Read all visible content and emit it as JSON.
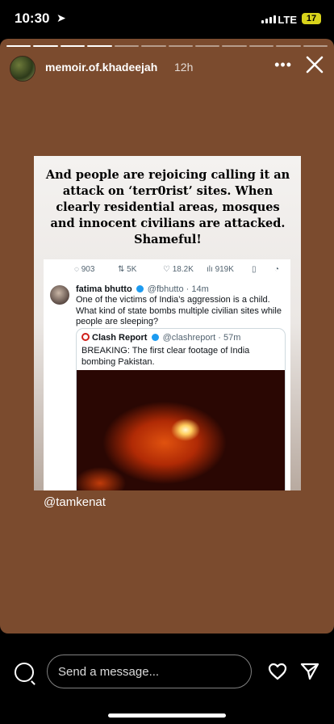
{
  "status": {
    "time": "10:30",
    "network": "LTE",
    "battery": "17"
  },
  "story": {
    "username": "memoir.of.khadeejah",
    "time_ago": "12h",
    "segments_total": 12,
    "segments_done": 4,
    "headline": "And people are rejoicing calling it an attack on ‘terr0rist’ sites. When clearly residential areas, mosques and innocent civilians are attacked. Shameful!",
    "mention": "@tamkenat"
  },
  "tweet": {
    "replies": "903",
    "retweets": "5K",
    "likes": "18.2K",
    "views": "919K",
    "author_name": "fatima bhutto",
    "author_handle": "@fbhutto",
    "author_time": "· 14m",
    "text": "One of the victims of India’s aggression is a child. What kind of state bombs multiple civilian sites while people are sleeping?",
    "quote": {
      "author_name": "Clash Report",
      "author_handle": "@clashreport",
      "author_time": "· 57m",
      "text": "BREAKING: The first clear footage of India bombing Pakistan."
    }
  },
  "composer": {
    "placeholder": "Send a message..."
  },
  "colors": {
    "story_bg": "#7b4b2e",
    "battery": "#d8d31b",
    "verified": "#1d9bf0",
    "clash_logo": "#d0201a"
  }
}
